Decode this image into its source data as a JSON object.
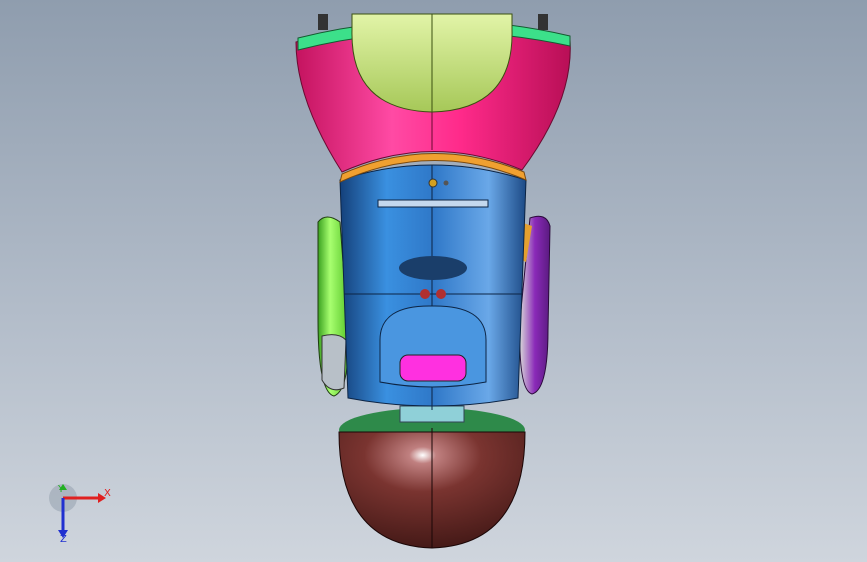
{
  "viewport": {
    "description_name": "cad-model-viewport"
  },
  "triad": {
    "x_label": "X",
    "y_label": "Y",
    "z_label": "Z",
    "x_color": "#e02020",
    "y_color": "#22b022",
    "z_color": "#2030d0"
  },
  "model_colors": {
    "top_cap": "#c8e87a",
    "collar": "#ff2a8a",
    "body": "#2f78c8",
    "ring": "#f0a030",
    "left_arm": "#7ef03a",
    "right_arm": "#8a2ab8",
    "base_dome": "#6a2a28",
    "base_ring": "#2e8a4a",
    "display": "#ff30e0"
  }
}
